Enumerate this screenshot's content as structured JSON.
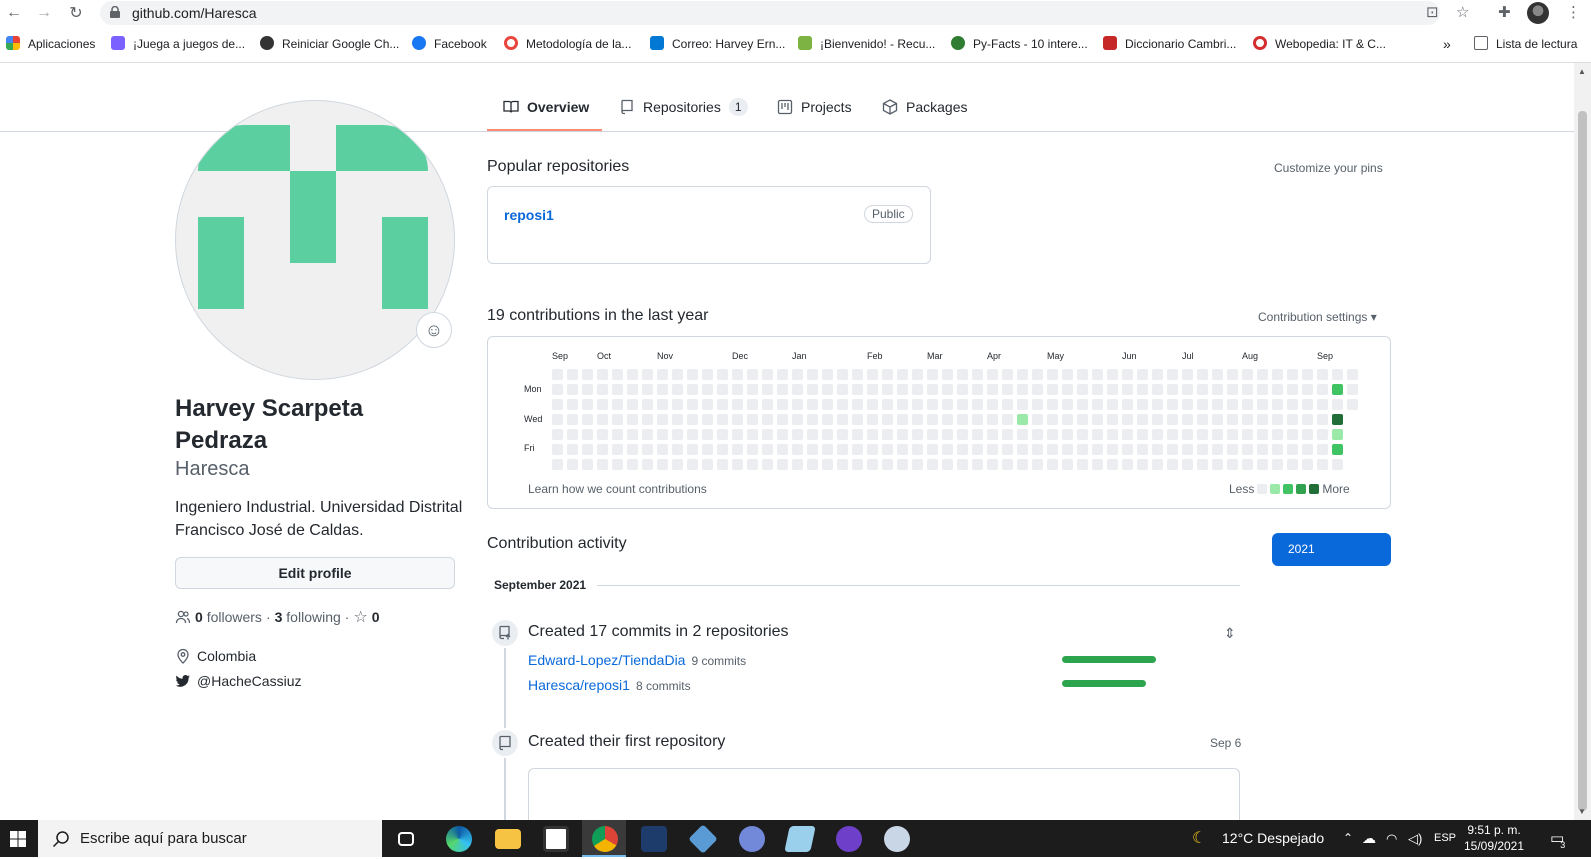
{
  "browser": {
    "url": "github.com/Haresca",
    "bookmarks": [
      {
        "label": "Aplicaciones",
        "color": "#ea4335"
      },
      {
        "label": "¡Juega a juegos de...",
        "color": "#7b61ff"
      },
      {
        "label": "Reiniciar Google Ch...",
        "color": "#333333"
      },
      {
        "label": "Facebook",
        "color": "#1877f2"
      },
      {
        "label": "Metodología de la...",
        "color": "#e8453c"
      },
      {
        "label": "Correo: Harvey Ern...",
        "color": "#0078d4"
      },
      {
        "label": "¡Bienvenido! - Recu...",
        "color": "#7cb342"
      },
      {
        "label": "Py-Facts - 10 intere...",
        "color": "#2e7d32"
      },
      {
        "label": "Diccionario Cambri...",
        "color": "#c62828"
      },
      {
        "label": "Webopedia: IT & C...",
        "color": "#d32f2f"
      }
    ],
    "overflow": "»",
    "reading_list": "Lista de lectura"
  },
  "tabs": [
    {
      "label": "Overview",
      "active": true
    },
    {
      "label": "Repositories",
      "count": "1"
    },
    {
      "label": "Projects"
    },
    {
      "label": "Packages"
    }
  ],
  "profile": {
    "fullname": "Harvey Scarpeta Pedraza",
    "username": "Haresca",
    "bio": "Ingeniero Industrial. Universidad Distrital Francisco José de Caldas.",
    "edit_label": "Edit profile",
    "followers_count": "0",
    "followers_label": "followers",
    "following_count": "3",
    "following_label": "following",
    "stars_count": "0",
    "location": "Colombia",
    "twitter": "@HacheCassiuz",
    "avatar_color": "#5ccfa1"
  },
  "popular": {
    "heading": "Popular repositories",
    "customize": "Customize your pins",
    "repo_name": "reposi1",
    "repo_visibility": "Public"
  },
  "contributions": {
    "heading": "19 contributions in the last year",
    "settings": "Contribution settings ▾",
    "months": [
      "Sep",
      "Oct",
      "Nov",
      "Dec",
      "Jan",
      "Feb",
      "Mar",
      "Apr",
      "May",
      "Jun",
      "Jul",
      "Aug",
      "Sep"
    ],
    "days": [
      "Mon",
      "Wed",
      "Fri"
    ],
    "learn": "Learn how we count contributions",
    "less": "Less",
    "more": "More",
    "levels": [
      "#ebedf0",
      "#9be9a8",
      "#40c463",
      "#30a14e",
      "#216e39"
    ]
  },
  "activity": {
    "heading": "Contribution activity",
    "year": "2021",
    "month": "September 2021",
    "commits_title": "Created 17 commits in 2 repositories",
    "repos": [
      {
        "name": "Edward-Lopez/TiendaDia",
        "commits": "9 commits",
        "share": 1.0
      },
      {
        "name": "Haresca/reposi1",
        "commits": "8 commits",
        "share": 0.89
      }
    ],
    "first_repo_title": "Created their first repository",
    "first_repo_date": "Sep 6"
  },
  "taskbar": {
    "search_placeholder": "Escribe aquí para buscar",
    "weather": "12°C  Despejado",
    "lang": "ESP",
    "time": "9:51 p. m.",
    "date": "15/09/2021",
    "notif": "3"
  }
}
